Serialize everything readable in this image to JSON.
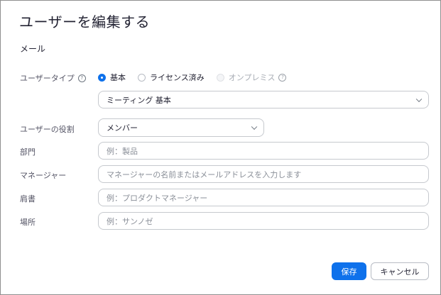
{
  "dialog": {
    "title": "ユーザーを編集する",
    "email_label": "メール"
  },
  "user_type": {
    "label": "ユーザータイプ",
    "options": [
      {
        "label": "基本",
        "checked": true,
        "disabled": false
      },
      {
        "label": "ライセンス済み",
        "checked": false,
        "disabled": false
      },
      {
        "label": "オンプレミス",
        "checked": false,
        "disabled": true
      }
    ],
    "help_icon": "info-circle",
    "plan_select_value": "ミーティング 基本"
  },
  "role": {
    "label": "ユーザーの役割",
    "select_value": "メンバー"
  },
  "fields": {
    "department": {
      "label": "部門",
      "placeholder": "例：製品"
    },
    "manager": {
      "label": "マネージャー",
      "placeholder": "マネージャーの名前またはメールアドレスを入力します"
    },
    "job_title": {
      "label": "肩書",
      "placeholder": "例：プロダクトマネージャー"
    },
    "location": {
      "label": "場所",
      "placeholder": "例：サンノゼ"
    }
  },
  "buttons": {
    "save": "保存",
    "cancel": "キャンセル"
  },
  "colors": {
    "accent": "#0e71eb",
    "text": "#232333",
    "border": "#c6c9ce"
  }
}
